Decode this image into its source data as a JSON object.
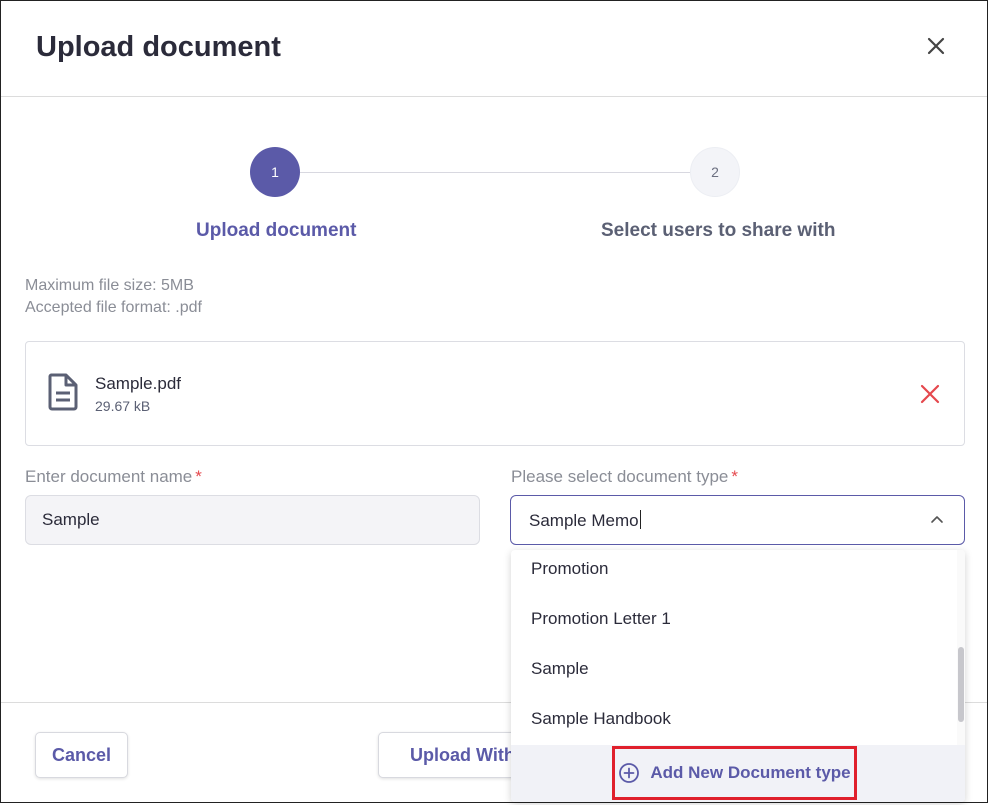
{
  "dialog": {
    "title": "Upload document"
  },
  "stepper": {
    "steps": [
      {
        "number": "1",
        "label": "Upload document"
      },
      {
        "number": "2",
        "label": "Select users to share with"
      }
    ]
  },
  "info": {
    "max_size": "Maximum file size: 5MB",
    "formats": "Accepted file format: .pdf"
  },
  "file": {
    "name": "Sample.pdf",
    "size": "29.67 kB"
  },
  "form": {
    "name_label": "Enter document name",
    "name_value": "Sample",
    "type_label": "Please select document type",
    "type_value": "Sample Memo",
    "required_mark": "*"
  },
  "dropdown": {
    "options": [
      "Promotion",
      "Promotion Letter 1",
      "Sample",
      "Sample Handbook"
    ],
    "add_new_label": "Add New Document type"
  },
  "footer": {
    "cancel_label": "Cancel",
    "upload_label": "Upload With"
  },
  "colors": {
    "accent": "#5b5aa8",
    "danger": "#e5484d",
    "highlight": "#e0202c"
  }
}
